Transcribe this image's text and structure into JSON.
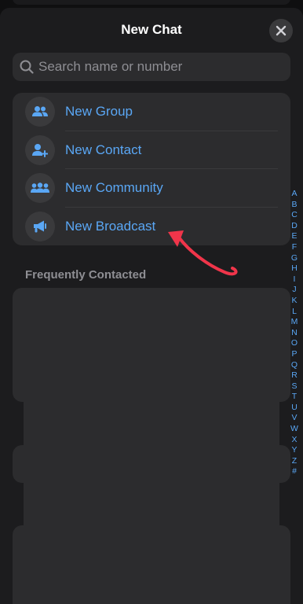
{
  "header": {
    "title": "New Chat",
    "close_icon": "close-icon"
  },
  "search": {
    "placeholder": "Search name or number",
    "value": "",
    "icon": "search-icon"
  },
  "actions": [
    {
      "label": "New Group",
      "icon": "group-icon"
    },
    {
      "label": "New Contact",
      "icon": "add-contact-icon"
    },
    {
      "label": "New Community",
      "icon": "community-icon"
    },
    {
      "label": "New Broadcast",
      "icon": "megaphone-icon"
    }
  ],
  "section": {
    "title": "Frequently Contacted"
  },
  "index_letters": [
    "A",
    "B",
    "C",
    "D",
    "E",
    "F",
    "G",
    "H",
    "I",
    "J",
    "K",
    "L",
    "M",
    "N",
    "O",
    "P",
    "Q",
    "R",
    "S",
    "T",
    "U",
    "V",
    "W",
    "X",
    "Y",
    "Z",
    "#"
  ],
  "colors": {
    "accent": "#5aa7f5",
    "sheet_background": "#1c1c1e",
    "cell_background": "#2c2c2e",
    "annotation_arrow": "#f0354a"
  }
}
